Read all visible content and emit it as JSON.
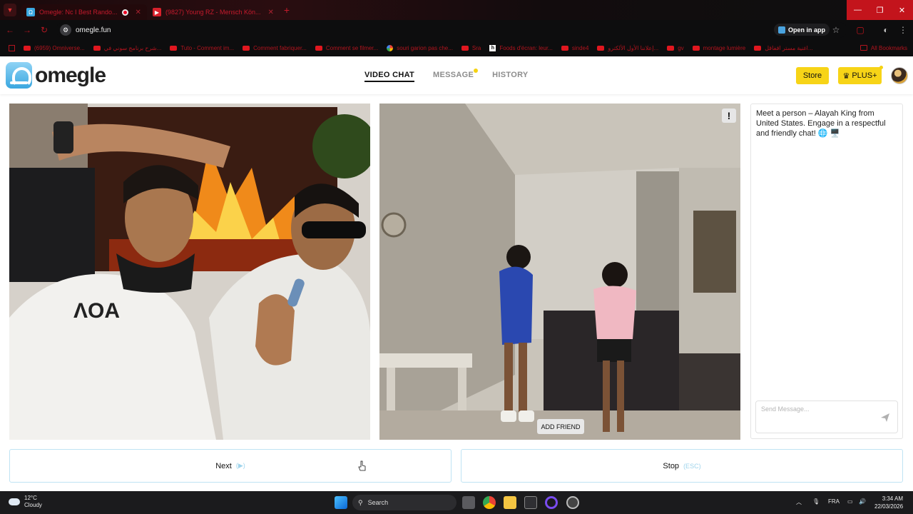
{
  "browser": {
    "tabs": [
      {
        "title": "Omegle: Nc I Best Rando...",
        "active": true
      },
      {
        "title": "(9827) Young RZ - Mensch Kön...",
        "active": false
      }
    ],
    "url": "omegle.fun",
    "open_in_app": "Open in app",
    "bookmarks": [
      "(6959) Omniverse...",
      "شرح برنامج سوني في...",
      "Tuto - Comment im...",
      "Comment fabriquer...",
      "Comment se filmer...",
      "souri garion pas che...",
      "Sra",
      "Foods d'écran: leur...",
      "sinde4",
      "إعلاننا الأول الألكترو...",
      "gv",
      "montage lumière",
      "اغنية مستر اقفاقل..."
    ],
    "all_bookmarks": "All Bookmarks"
  },
  "site": {
    "logo_text": "omegle",
    "nav": [
      {
        "label": "VIDEO CHAT",
        "active": true
      },
      {
        "label": "MESSAGE",
        "active": false,
        "dot": true
      },
      {
        "label": "HISTORY",
        "active": false
      }
    ],
    "store_label": "Store",
    "plus_label": "PLUS+",
    "plus_icon": "crown-icon"
  },
  "video": {
    "report_label": "!",
    "add_friend_label": "ADD FRIEND"
  },
  "chat": {
    "intro_message": "Meet a person – Alayah King from United States. Engage in a respectful and friendly chat! 🌐 🖥️",
    "input_placeholder": "Send Message..."
  },
  "controls": {
    "next_label": "Next",
    "next_hint": "(▶)",
    "stop_label": "Stop",
    "stop_hint": "(ESC)"
  },
  "taskbar": {
    "temperature": "12°C",
    "weather": "Cloudy",
    "search_label": "Search",
    "language": "FRA",
    "time": "3:34 AM",
    "date": "22/03/2026"
  },
  "colors": {
    "accent_yellow": "#f7d417",
    "browser_red": "#c3141c",
    "button_border": "#bfe3f3"
  }
}
